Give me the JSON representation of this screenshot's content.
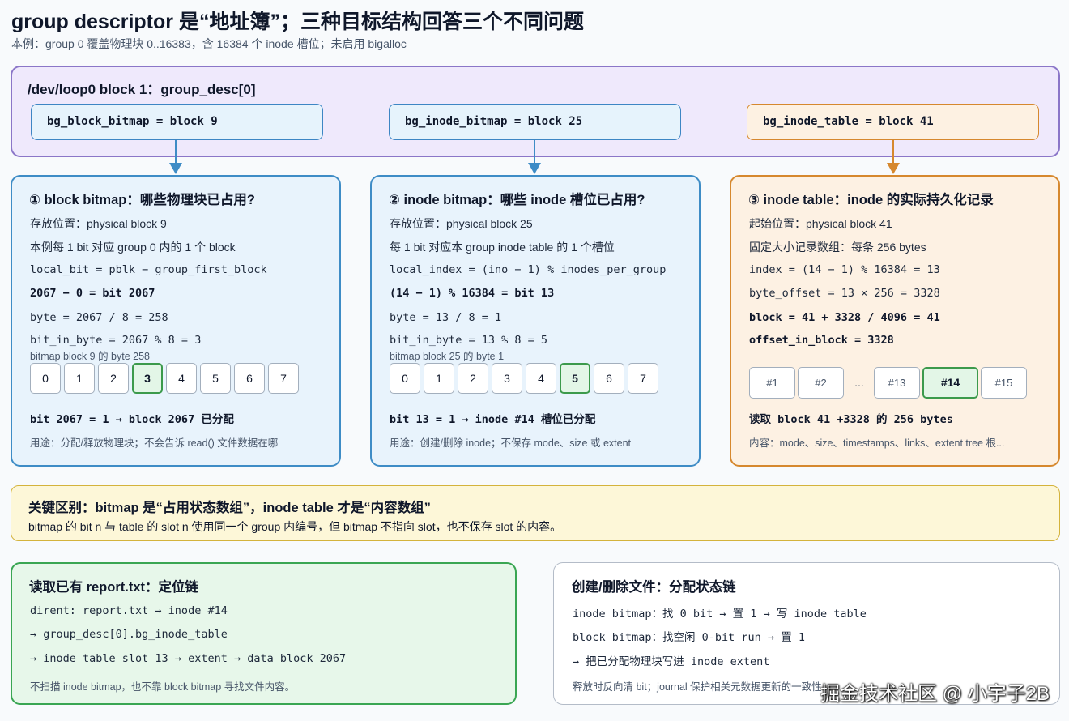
{
  "header": {
    "title": "group descriptor 是“地址簿”；三种目标结构回答三个不同问题",
    "subtitle": "本例：group 0 覆盖物理块 0..16383，含 16384 个 inode 槽位；未启用 bigalloc"
  },
  "descriptor": {
    "title": "/dev/loop0 block 1：group_desc[0]",
    "fields": [
      "bg_block_bitmap = block 9",
      "bg_inode_bitmap = block 25",
      "bg_inode_table = block 41"
    ]
  },
  "cards": [
    {
      "title": "① block bitmap：哪些物理块已占用?",
      "lines": [
        "存放位置：physical block 9",
        "本例每 1 bit 对应 group 0 内的 1 个 block",
        "local_bit = pblk − group_first_block",
        "2067 − 0 = bit 2067",
        "byte = 2067 / 8 = 258",
        "bit_in_byte = 2067 % 8 = 3"
      ],
      "caption": "bitmap block 9 的 byte 258",
      "bits": [
        "0",
        "1",
        "2",
        "3",
        "4",
        "5",
        "6",
        "7"
      ],
      "highlight_bit": 3,
      "result": "bit 2067 = 1 → block 2067 已分配",
      "note": "用途：分配/释放物理块；不会告诉 read() 文件数据在哪"
    },
    {
      "title": "② inode bitmap：哪些 inode 槽位已占用?",
      "lines": [
        "存放位置：physical block 25",
        "每 1 bit 对应本 group inode table 的 1 个槽位",
        "local_index = (ino − 1) % inodes_per_group",
        "(14 − 1) % 16384 = bit 13",
        "byte = 13 / 8 = 1",
        "bit_in_byte = 13 % 8 = 5"
      ],
      "caption": "bitmap block 25 的 byte 1",
      "bits": [
        "0",
        "1",
        "2",
        "3",
        "4",
        "5",
        "6",
        "7"
      ],
      "highlight_bit": 5,
      "result": "bit 13 = 1 → inode #14 槽位已分配",
      "note": "用途：创建/删除 inode；不保存 mode、size 或 extent"
    },
    {
      "title": "③ inode table：inode 的实际持久化记录",
      "lines": [
        "起始位置：physical block 41",
        "固定大小记录数组：每条 256 bytes",
        "index = (14 − 1) % 16384 = 13",
        "byte_offset = 13 × 256 = 3328",
        "block = 41 + 3328 / 4096 = 41",
        "offset_in_block = 3328"
      ],
      "slots": [
        "#1",
        "#2",
        "...",
        "#13",
        "#14",
        "#15"
      ],
      "highlight_slot": "#14",
      "result": "读取 block 41 +3328 的 256 bytes",
      "note": "内容：mode、size、timestamps、links、extent tree 根..."
    }
  ],
  "key": {
    "title": "关键区别：bitmap 是“占用状态数组”，inode table 才是“内容数组”",
    "text": "bitmap 的 bit n 与 table 的 slot n 使用同一个 group 内编号，但 bitmap 不指向 slot，也不保存 slot 的内容。"
  },
  "read_chain": {
    "title": "读取已有 report.txt：定位链",
    "lines": [
      "dirent: report.txt → inode #14",
      "→ group_desc[0].bg_inode_table",
      "→ inode table slot 13 → extent → data block 2067"
    ],
    "note": "不扫描 inode bitmap，也不靠 block bitmap 寻找文件内容。"
  },
  "alloc_chain": {
    "title": "创建/删除文件：分配状态链",
    "lines": [
      "inode bitmap：找 0 bit → 置 1 → 写 inode table",
      "block bitmap：找空闲 0-bit run → 置 1",
      "→ 把已分配物理块写进 inode extent"
    ],
    "note": "释放时反向清 bit；journal 保护相关元数据更新的一致性"
  },
  "watermark": "掘金技术社区 @ 小宇子2B",
  "colors": {
    "purple": "#8b76c8",
    "blue": "#3e8cc6",
    "orange": "#d6882e",
    "green": "#3aa653",
    "yellow": "#d4b33c"
  }
}
